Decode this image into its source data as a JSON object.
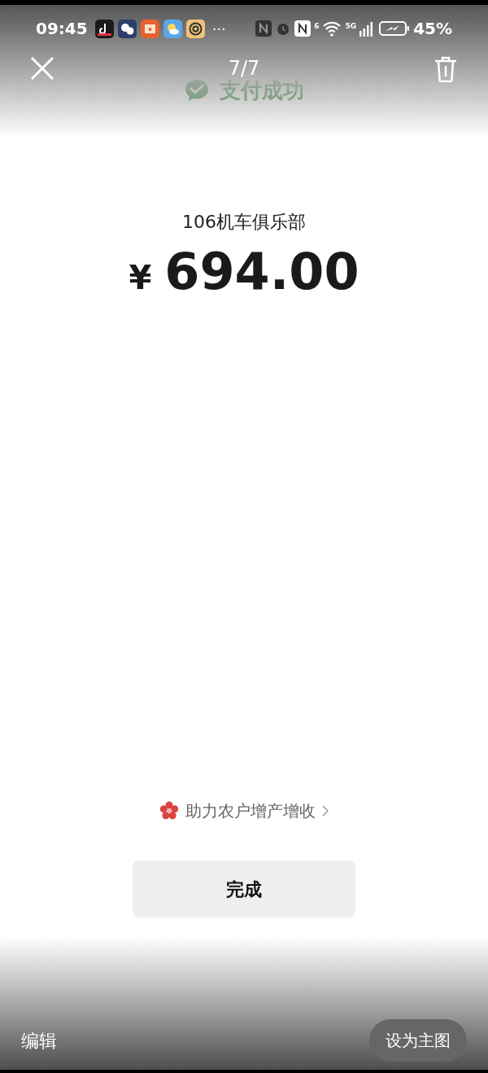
{
  "status_bar": {
    "time": "09:45",
    "more": "···",
    "wifi_tag": "6",
    "network": "5G",
    "battery": "45%"
  },
  "viewer": {
    "counter": "7/7",
    "edit": "编辑",
    "set_cover": "设为主图"
  },
  "receipt": {
    "status": "支付成功",
    "merchant": "106机车俱乐部",
    "currency": "¥",
    "amount": "694.00",
    "promo": "助力农户增产增收",
    "done": "完成"
  }
}
